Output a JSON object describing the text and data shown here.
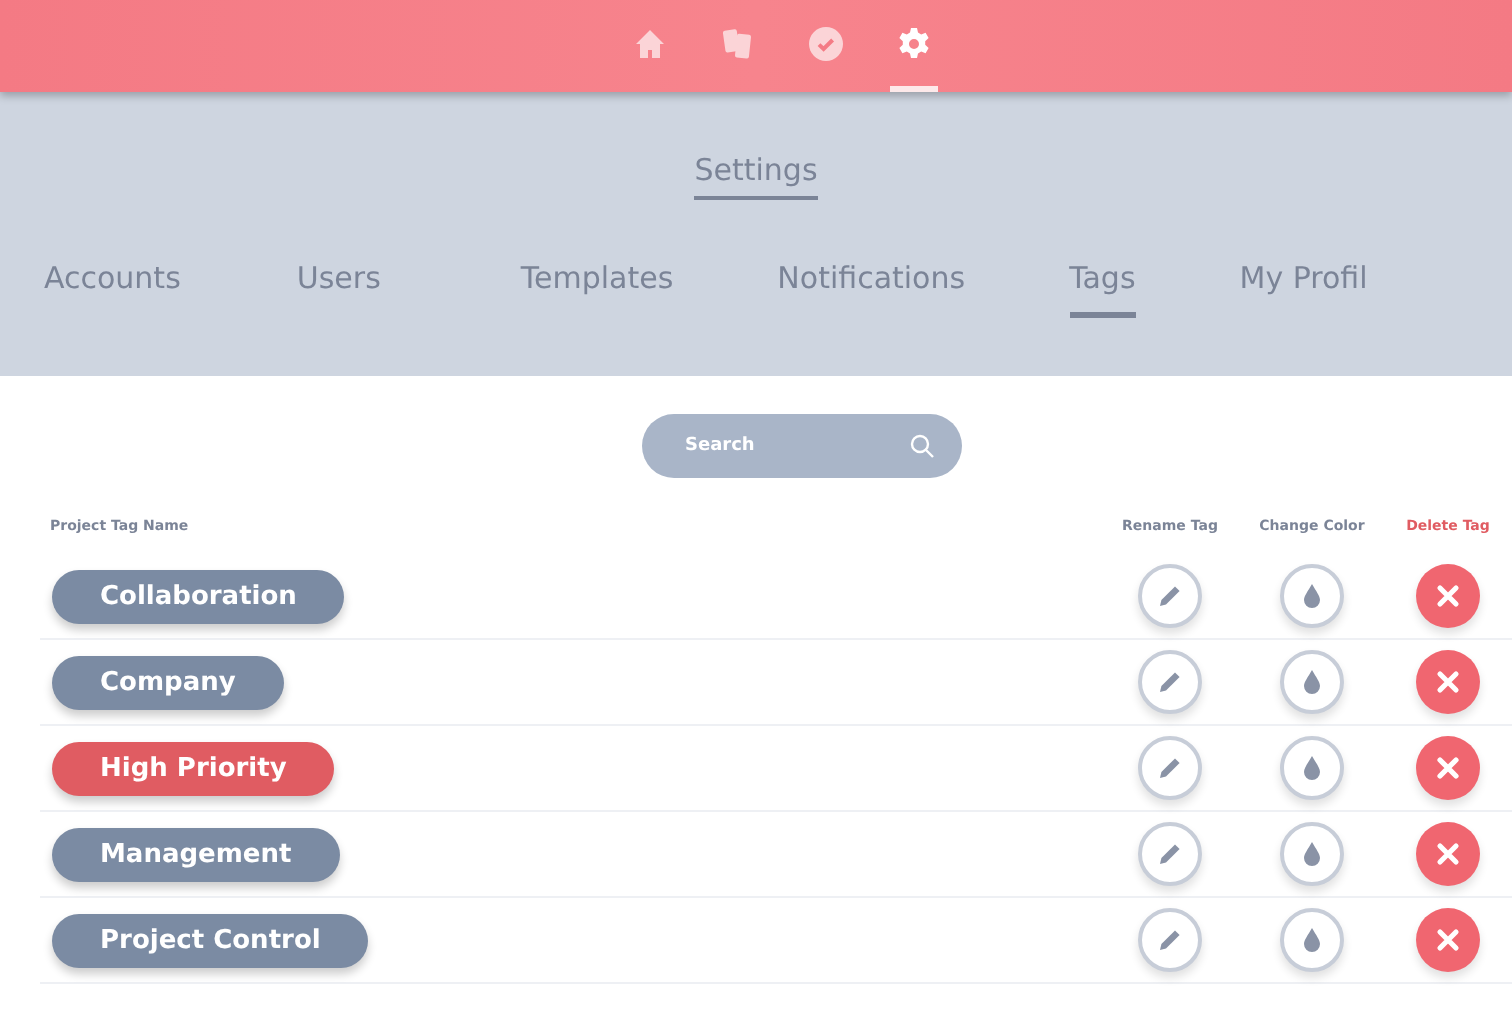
{
  "nav": [
    {
      "kind": "home",
      "selected": false
    },
    {
      "kind": "cards",
      "selected": false
    },
    {
      "kind": "check",
      "selected": false
    },
    {
      "kind": "settings",
      "selected": true
    }
  ],
  "title": "Settings",
  "tabs": [
    {
      "label": "Accounts",
      "selected": false
    },
    {
      "label": "Users",
      "selected": false
    },
    {
      "label": "Templates",
      "selected": false
    },
    {
      "label": "Notifications",
      "selected": false
    },
    {
      "label": "Tags",
      "selected": true
    },
    {
      "label": "My Profil",
      "selected": false
    }
  ],
  "search": {
    "placeholder": "Search"
  },
  "columns": [
    {
      "label": "Project Tag Name",
      "kind": "name"
    },
    {
      "label": "Rename Tag",
      "kind": "rename"
    },
    {
      "label": "Change Color",
      "kind": "color"
    },
    {
      "label": "Delete Tag",
      "kind": "delete"
    }
  ],
  "tags": [
    {
      "name": "Collaboration",
      "color": "#7b8ba3"
    },
    {
      "name": "Company",
      "color": "#7b8ba3"
    },
    {
      "name": "High Priority",
      "color": "#e05c62"
    },
    {
      "name": "Management",
      "color": "#7b8ba3"
    },
    {
      "name": "Project Control",
      "color": "#7b8ba3"
    }
  ]
}
